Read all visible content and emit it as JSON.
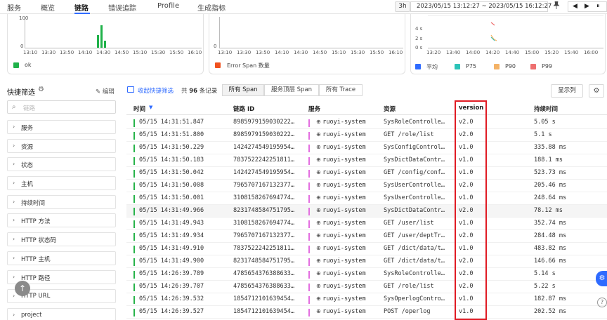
{
  "nav": {
    "tabs": [
      "服务",
      "概览",
      "链路",
      "错误追踪",
      "Profile",
      "生成指标"
    ],
    "active_tab": "链路",
    "range_button": "3h",
    "time_range": "2023/05/15 13:12:27 ~ 2023/05/15 16:12:27",
    "pin_icon": "pin-icon",
    "prev_icon": "◀",
    "next_icon": "▶",
    "pause_icon": "⏸"
  },
  "chart1": {
    "y_ticks": [
      "100",
      "0"
    ],
    "x_ticks": [
      "13:10",
      "13:30",
      "13:50",
      "14:10",
      "14:30",
      "14:50",
      "15:10",
      "15:30",
      "15:50",
      "16:10"
    ],
    "legend": "ok",
    "legend_color": "#20b24a"
  },
  "chart2": {
    "y_ticks": [
      "0"
    ],
    "x_ticks": [
      "13:10",
      "13:30",
      "13:50",
      "14:10",
      "14:30",
      "14:50",
      "15:10",
      "15:30",
      "15:50",
      "16:10"
    ],
    "legend": "Error Span 数量",
    "legend_color": "#f0521f"
  },
  "chart3": {
    "y_ticks": [
      "4 s",
      "2 s",
      "0 s"
    ],
    "x_ticks": [
      "13:20",
      "13:40",
      "14:00",
      "14:20",
      "14:40",
      "15:00",
      "15:20",
      "15:40",
      "16:00"
    ],
    "legend": [
      {
        "label": "平均",
        "color": "#2f6bff"
      },
      {
        "label": "P75",
        "color": "#2cc3b8"
      },
      {
        "label": "P90",
        "color": "#f4b266"
      },
      {
        "label": "P99",
        "color": "#ee6f6f"
      }
    ]
  },
  "quick_filter": {
    "title": "快捷筛选",
    "edit_label": "编辑",
    "search_placeholder": "链路",
    "facets": [
      "服务",
      "资源",
      "状态",
      "主机",
      "持续时间",
      "HTTP 方法",
      "HTTP 状态码",
      "HTTP 主机",
      "HTTP 路径",
      "HTTP URL",
      "project"
    ]
  },
  "toolbar": {
    "collapse_label": "收起快捷筛选",
    "count_prefix": "共",
    "count": "96",
    "count_suffix": "条记录",
    "segments": [
      "所有 Span",
      "服务顶层 Span",
      "所有 Trace"
    ],
    "display_columns": "显示列"
  },
  "table": {
    "headers": [
      "时间",
      "链路 ID",
      "服务",
      "资源",
      "version",
      "持续时间"
    ],
    "rows": [
      {
        "time": "05/15 14:31:51.847",
        "trace": "8985979159030222…",
        "service": "ruoyi-system",
        "resource": "SysRoleControlle…",
        "version": "v2.0",
        "duration": "5.05 s"
      },
      {
        "time": "05/15 14:31:51.800",
        "trace": "8985979159030222…",
        "service": "ruoyi-system",
        "resource": "GET /role/list",
        "version": "v2.0",
        "duration": "5.1 s"
      },
      {
        "time": "05/15 14:31:50.229",
        "trace": "1424274549195954…",
        "service": "ruoyi-system",
        "resource": "SysConfigControl…",
        "version": "v1.0",
        "duration": "335.88 ms"
      },
      {
        "time": "05/15 14:31:50.183",
        "trace": "7837522242251811…",
        "service": "ruoyi-system",
        "resource": "SysDictDataContr…",
        "version": "v1.0",
        "duration": "188.1 ms"
      },
      {
        "time": "05/15 14:31:50.042",
        "trace": "1424274549195954…",
        "service": "ruoyi-system",
        "resource": "GET /config/conf…",
        "version": "v1.0",
        "duration": "523.73 ms"
      },
      {
        "time": "05/15 14:31:50.008",
        "trace": "7965707167132377…",
        "service": "ruoyi-system",
        "resource": "SysUserControlle…",
        "version": "v2.0",
        "duration": "205.46 ms"
      },
      {
        "time": "05/15 14:31:50.001",
        "trace": "3108158267694774…",
        "service": "ruoyi-system",
        "resource": "SysUserControlle…",
        "version": "v1.0",
        "duration": "248.64 ms"
      },
      {
        "time": "05/15 14:31:49.966",
        "trace": "8231748584751795…",
        "service": "ruoyi-system",
        "resource": "SysDictDataContr…",
        "version": "v2.0",
        "duration": "78.12 ms"
      },
      {
        "time": "05/15 14:31:49.943",
        "trace": "3108158267694774…",
        "service": "ruoyi-system",
        "resource": "GET /user/list",
        "version": "v1.0",
        "duration": "352.74 ms"
      },
      {
        "time": "05/15 14:31:49.934",
        "trace": "7965707167132377…",
        "service": "ruoyi-system",
        "resource": "GET /user/deptTr…",
        "version": "v2.0",
        "duration": "284.48 ms"
      },
      {
        "time": "05/15 14:31:49.910",
        "trace": "7837522242251811…",
        "service": "ruoyi-system",
        "resource": "GET /dict/data/t…",
        "version": "v1.0",
        "duration": "483.82 ms"
      },
      {
        "time": "05/15 14:31:49.900",
        "trace": "8231748584751795…",
        "service": "ruoyi-system",
        "resource": "GET /dict/data/t…",
        "version": "v2.0",
        "duration": "146.66 ms"
      },
      {
        "time": "05/15 14:26:39.789",
        "trace": "4785654376388633…",
        "service": "ruoyi-system",
        "resource": "SysRoleControlle…",
        "version": "v2.0",
        "duration": "5.14 s"
      },
      {
        "time": "05/15 14:26:39.707",
        "trace": "4785654376388633…",
        "service": "ruoyi-system",
        "resource": "GET /role/list",
        "version": "v2.0",
        "duration": "5.22 s"
      },
      {
        "time": "05/15 14:26:39.532",
        "trace": "1854712101639454…",
        "service": "ruoyi-system",
        "resource": "SysOperlogContro…",
        "version": "v1.0",
        "duration": "182.87 ms"
      },
      {
        "time": "05/15 14:26:39.527",
        "trace": "1854712101639454…",
        "service": "ruoyi-system",
        "resource": "POST /operlog",
        "version": "v1.0",
        "duration": "202.52 ms"
      }
    ]
  }
}
